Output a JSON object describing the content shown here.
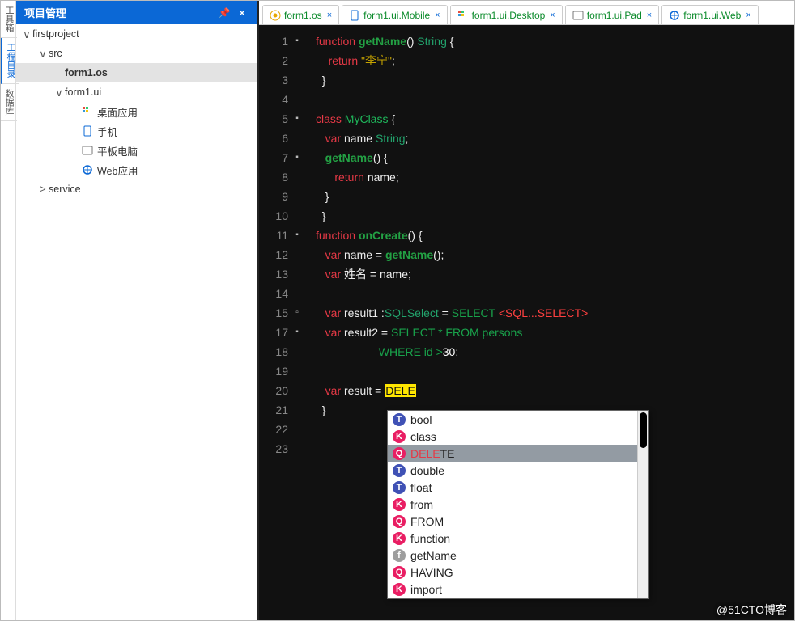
{
  "toolTabs": [
    {
      "label": "工具箱",
      "active": false
    },
    {
      "label": "工程目录",
      "active": true
    },
    {
      "label": "数据库",
      "active": false
    }
  ],
  "sidebar": {
    "title": "项目管理",
    "pin_icon": "pin-icon",
    "close_icon": "close-icon",
    "tree": [
      {
        "label": "firstproject",
        "indent": 0,
        "twist": "∨",
        "icon": ""
      },
      {
        "label": "src",
        "indent": 1,
        "twist": "∨",
        "icon": ""
      },
      {
        "label": "form1.os",
        "indent": 2,
        "twist": "",
        "icon": "",
        "selected": true
      },
      {
        "label": "form1.ui",
        "indent": 2,
        "twist": "∨",
        "icon": ""
      },
      {
        "label": "桌面应用",
        "indent": 3,
        "twist": "",
        "icon": "desktop"
      },
      {
        "label": "手机",
        "indent": 3,
        "twist": "",
        "icon": "mobile"
      },
      {
        "label": "平板电脑",
        "indent": 3,
        "twist": "",
        "icon": "pad"
      },
      {
        "label": "Web应用",
        "indent": 3,
        "twist": "",
        "icon": "web"
      },
      {
        "label": "service",
        "indent": 1,
        "twist": ">",
        "icon": ""
      }
    ]
  },
  "tabs": [
    {
      "label": "form1.os",
      "icon": "os"
    },
    {
      "label": "form1.ui.Mobile",
      "icon": "mobile"
    },
    {
      "label": "form1.ui.Desktop",
      "icon": "desktop"
    },
    {
      "label": "form1.ui.Pad",
      "icon": "pad"
    },
    {
      "label": "form1.ui.Web",
      "icon": "web"
    }
  ],
  "tabs_close": "×",
  "code": {
    "lines": [
      {
        "n": 1,
        "fold": "▪",
        "segs": [
          [
            "kw-red",
            "function "
          ],
          [
            "kw-func",
            "getName"
          ],
          [
            "",
            ""
          ],
          [
            "",
            "() "
          ],
          [
            "kw-type",
            "String"
          ],
          [
            "",
            " {"
          ]
        ]
      },
      {
        "n": 2,
        "fold": "",
        "segs": [
          [
            "",
            "    "
          ],
          [
            "kw-red",
            "return "
          ],
          [
            "kw-str",
            "\"李宁\""
          ],
          [
            "",
            ";"
          ]
        ]
      },
      {
        "n": 3,
        "fold": "",
        "segs": [
          [
            "",
            "  }"
          ]
        ]
      },
      {
        "n": 4,
        "fold": "",
        "segs": [
          [
            "",
            ""
          ]
        ]
      },
      {
        "n": 5,
        "fold": "▪",
        "segs": [
          [
            "kw-red",
            "class "
          ],
          [
            "kw-class",
            "MyClass"
          ],
          [
            "",
            " {"
          ]
        ]
      },
      {
        "n": 6,
        "fold": "",
        "segs": [
          [
            "",
            "   "
          ],
          [
            "kw-red",
            "var "
          ],
          [
            "",
            "name "
          ],
          [
            "kw-type",
            "String"
          ],
          [
            "",
            ";"
          ]
        ]
      },
      {
        "n": 7,
        "fold": "▪",
        "segs": [
          [
            "",
            "   "
          ],
          [
            "kw-func",
            "getName"
          ],
          [
            "",
            "() {"
          ]
        ]
      },
      {
        "n": 8,
        "fold": "",
        "segs": [
          [
            "",
            "      "
          ],
          [
            "kw-red",
            "return "
          ],
          [
            "",
            "name;"
          ]
        ]
      },
      {
        "n": 9,
        "fold": "",
        "segs": [
          [
            "",
            "   }"
          ]
        ]
      },
      {
        "n": 10,
        "fold": "",
        "segs": [
          [
            "",
            "  }"
          ]
        ]
      },
      {
        "n": 11,
        "fold": "▪",
        "segs": [
          [
            "kw-red",
            "function "
          ],
          [
            "kw-func",
            "onCreate"
          ],
          [
            "",
            "() {"
          ]
        ]
      },
      {
        "n": 12,
        "fold": "",
        "segs": [
          [
            "",
            "   "
          ],
          [
            "kw-red",
            "var "
          ],
          [
            "",
            "name = "
          ],
          [
            "kw-func",
            "getName"
          ],
          [
            "",
            "();"
          ]
        ]
      },
      {
        "n": 13,
        "fold": "",
        "segs": [
          [
            "",
            "   "
          ],
          [
            "kw-red",
            "var "
          ],
          [
            "",
            "姓名 = name;"
          ]
        ]
      },
      {
        "n": 14,
        "fold": "",
        "segs": [
          [
            "",
            ""
          ]
        ]
      },
      {
        "n": 15,
        "fold": "▫",
        "segs": [
          [
            "",
            "   "
          ],
          [
            "kw-red",
            "var "
          ],
          [
            "",
            "result1 :"
          ],
          [
            "kw-type",
            "SQLSelect"
          ],
          [
            "",
            " = "
          ],
          [
            "kw-green",
            "SELECT "
          ],
          [
            "sql-angle",
            "<SQL...SELECT>"
          ]
        ]
      },
      {
        "n": 17,
        "fold": "▪",
        "segs": [
          [
            "",
            "   "
          ],
          [
            "kw-red",
            "var "
          ],
          [
            "",
            "result2 = "
          ],
          [
            "kw-green",
            "SELECT * FROM persons"
          ]
        ]
      },
      {
        "n": 18,
        "fold": "",
        "segs": [
          [
            "",
            "                    "
          ],
          [
            "kw-green",
            "WHERE id >"
          ],
          [
            "num",
            "30"
          ],
          [
            "",
            ";"
          ]
        ]
      },
      {
        "n": 19,
        "fold": "",
        "segs": [
          [
            "",
            ""
          ]
        ]
      },
      {
        "n": 20,
        "fold": "",
        "segs": [
          [
            "",
            "   "
          ],
          [
            "kw-red",
            "var "
          ],
          [
            "",
            "result = "
          ],
          [
            "cursor-hl",
            "DELE"
          ]
        ]
      },
      {
        "n": 21,
        "fold": "",
        "segs": [
          [
            "",
            "  }"
          ]
        ]
      },
      {
        "n": 22,
        "fold": "",
        "segs": [
          [
            "",
            ""
          ]
        ]
      },
      {
        "n": 23,
        "fold": "",
        "segs": [
          [
            "",
            ""
          ]
        ]
      }
    ]
  },
  "autocomplete": [
    {
      "type": "T",
      "color": "#3f51b5",
      "text": "bool",
      "match": 0
    },
    {
      "type": "K",
      "color": "#e91e63",
      "text": "class",
      "match": 0
    },
    {
      "type": "Q",
      "color": "#e91e63",
      "text": "DELETE",
      "match": 4,
      "selected": true
    },
    {
      "type": "T",
      "color": "#3f51b5",
      "text": "double",
      "match": 0
    },
    {
      "type": "T",
      "color": "#3f51b5",
      "text": "float",
      "match": 0
    },
    {
      "type": "K",
      "color": "#e91e63",
      "text": "from",
      "match": 0
    },
    {
      "type": "Q",
      "color": "#e91e63",
      "text": "FROM",
      "match": 0
    },
    {
      "type": "K",
      "color": "#e91e63",
      "text": "function",
      "match": 0
    },
    {
      "type": "f",
      "color": "#9e9e9e",
      "text": "getName",
      "match": 0
    },
    {
      "type": "Q",
      "color": "#e91e63",
      "text": "HAVING",
      "match": 0
    },
    {
      "type": "K",
      "color": "#e91e63",
      "text": "import",
      "match": 0
    }
  ],
  "watermark": "@51CTO博客"
}
